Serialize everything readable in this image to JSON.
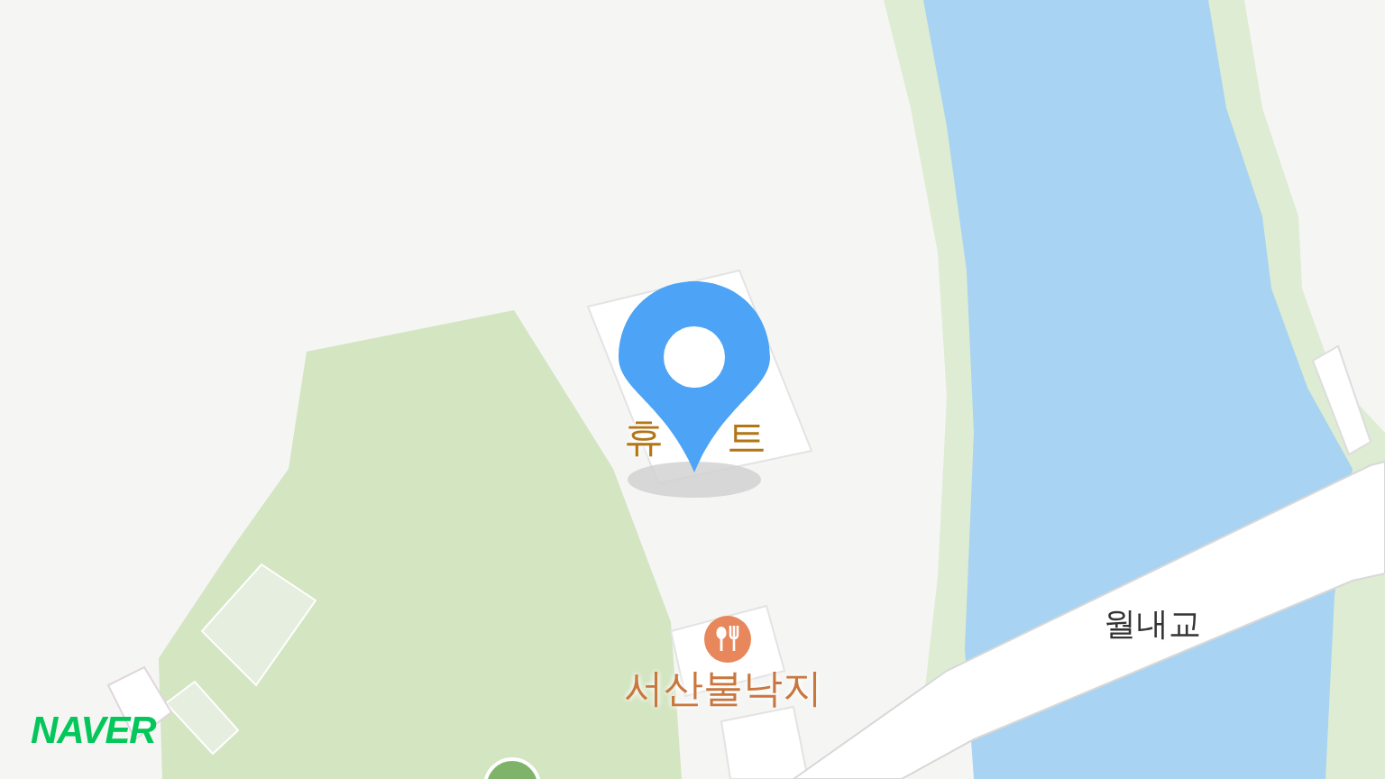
{
  "map": {
    "labels": [
      {
        "kind": "place",
        "text": "휴"
      },
      {
        "kind": "place",
        "text": "트"
      },
      {
        "kind": "road",
        "text": "월내교"
      },
      {
        "kind": "restaurant",
        "text": "서산불낙지"
      }
    ],
    "logo": "NAVER"
  }
}
